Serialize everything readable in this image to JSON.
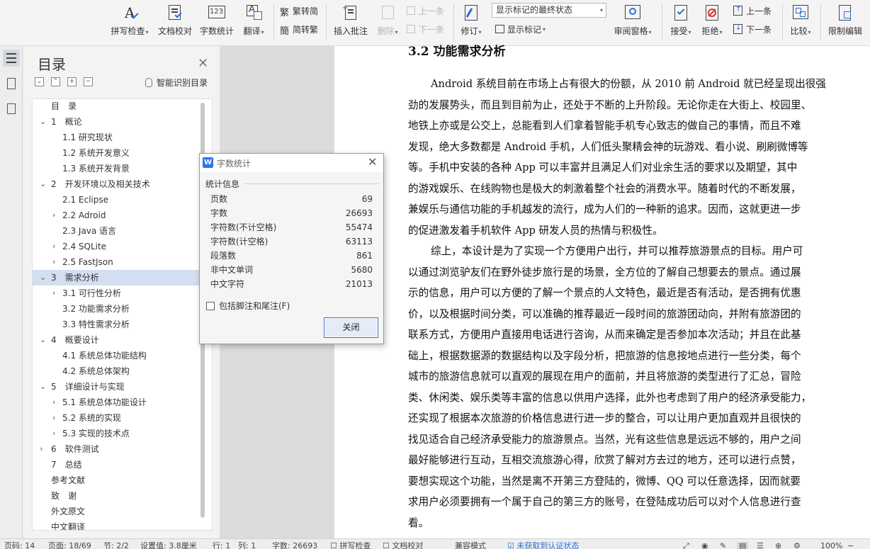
{
  "ribbon": {
    "spell_check": "拼写检查",
    "doc_proof": "文档校对",
    "word_count": "字数统计",
    "translate": "翻译",
    "trad_chinese": "繁转简",
    "simp_chinese": "简转繁",
    "insert_comment": "插入批注",
    "delete": "删除",
    "prev_comment": "上一条",
    "next_comment": "下一条",
    "revise": "修订",
    "markup_state": "显示标记的最终状态",
    "show_markup": "显示标记",
    "review_pane": "审阅窗格",
    "accept": "接受",
    "reject": "拒绝",
    "prev_change": "上一条",
    "next_change": "下一条",
    "compare": "比较",
    "restrict_edit": "限制编辑",
    "wc_icon_text": "123"
  },
  "toc": {
    "title": "目录",
    "smart_label": "智能识别目录",
    "items": [
      {
        "label": "目　录"
      },
      {
        "label": "1　概论"
      },
      {
        "label": "1.1  研究现状"
      },
      {
        "label": "1.2  系统开发意义"
      },
      {
        "label": "1.3  系统开发背景"
      },
      {
        "label": "2　开发环境以及相关技术"
      },
      {
        "label": "2.1 Eclipse"
      },
      {
        "label": "2.2 Adroid"
      },
      {
        "label": "2.3 Java 语言"
      },
      {
        "label": "2.4 SQLite"
      },
      {
        "label": "2.5 FastJson"
      },
      {
        "label": "3　需求分析"
      },
      {
        "label": "3.1  可行性分析"
      },
      {
        "label": "3.2  功能需求分析"
      },
      {
        "label": "3.3  特性需求分析"
      },
      {
        "label": "4　概要设计"
      },
      {
        "label": "4.1  系统总体功能结构"
      },
      {
        "label": "4.2  系统总体架构"
      },
      {
        "label": "5　详细设计与实现"
      },
      {
        "label": "5.1  系统总体功能设计"
      },
      {
        "label": "5.2  系统的实现"
      },
      {
        "label": "5.3  实现的技术点"
      },
      {
        "label": "6　软件测试"
      },
      {
        "label": "7　总结"
      },
      {
        "label": "参考文献"
      },
      {
        "label": "致　谢"
      },
      {
        "label": "外文原文"
      },
      {
        "label": "中文翻译"
      }
    ]
  },
  "document": {
    "heading": "3.2  功能需求分析",
    "para1": [
      "Android 系统目前在市场上占有很大的份额，从 2010 前 Android 就已经呈现出很强",
      "劲的发展势头，而且到目前为止，还处于不断的上升阶段。无论你走在大街上、校园里、",
      "地铁上亦或是公交上，总能看到人们拿着智能手机专心致志的做自己的事情，而且不难",
      "发现，绝大多数都是 Android 手机，人们低头聚精会神的玩游戏、看小说、刷刷微博等",
      "等。手机中安装的各种 App 可以丰富并且满足人们对业余生活的要求以及期望，其中",
      "的游戏娱乐、在线购物也是极大的刺激着整个社会的消费水平。随着时代的不断发展，",
      "兼娱乐与通信功能的手机越发的流行，成为人们的一种新的追求。因而，这就更进一步",
      "的促进激发着手机软件 App 研发人员的热情与积极性。"
    ],
    "para2": [
      "综上，本设计是为了实现一个方便用户出行，并可以推荐旅游景点的目标。用户可",
      "以通过浏览驴友们在野外徒步旅行是的场景，全方位的了解自己想要去的景点。通过展",
      "示的信息，用户可以方便的了解一个景点的人文特色，最近是否有活动，是否拥有优惠",
      "价，以及根据时间分类，可以准确的推荐最近一段时间的旅游团动向，并附有旅游团的",
      "联系方式，方便用户直接用电话进行咨询，从而来确定是否参加本次活动；并且在此基",
      "础上，根据数据源的数据结构以及字段分析，把旅游的信息按地点进行一些分类，每个",
      "城市的旅游信息就可以直观的展现在用户的面前，并且将旅游的类型进行了汇总，冒险",
      "类、休闲类、娱乐类等丰富的信息以供用户选择，此外也考虑到了用户的经济承受能力，",
      "还实现了根据本次旅游的价格信息进行进一步的整合，可以让用户更加直观并且很快的",
      "找见适合自己经济承受能力的旅游景点。当然，光有这些信息是远远不够的，用户之间",
      "最好能够进行互动，互相交流旅游心得，欣赏了解对方去过的地方，还可以进行点赞，",
      "要想实现这个功能，当然是离不开第三方登陆的，微博、QQ 可以任意选择，因而就要",
      "求用户必须要拥有一个属于自己的第三方的账号，在登陆成功后可以对个人信息进行查",
      "看。"
    ]
  },
  "dialog": {
    "title": "字数统计",
    "logo": "W",
    "group": "统计信息",
    "stats": [
      {
        "label": "页数",
        "value": "69"
      },
      {
        "label": "字数",
        "value": "26693"
      },
      {
        "label": "字符数(不计空格)",
        "value": "55474"
      },
      {
        "label": "字符数(计空格)",
        "value": "63113"
      },
      {
        "label": "段落数",
        "value": "861"
      },
      {
        "label": "非中文单词",
        "value": "5680"
      },
      {
        "label": "中文字符",
        "value": "21013"
      }
    ],
    "checkbox_label": "包括脚注和尾注(F)",
    "close_button": "关闭"
  },
  "status": {
    "page_num": "页码: 14",
    "page_of": "页面: 18/69",
    "section": "节: 2/2",
    "setting": "设置值: 3.8厘米",
    "row": "行: 1",
    "col": "列: 1",
    "words": "字数: 26693",
    "spell": "拼写检查",
    "proof": "文档校对",
    "compat": "兼容模式",
    "auth": "未获取到认证状态",
    "zoom": "100%"
  },
  "colors": {
    "accent": "#2a6fd6",
    "selected_row": "#d3dff0",
    "dialog_button_border": "#3e74c8"
  }
}
